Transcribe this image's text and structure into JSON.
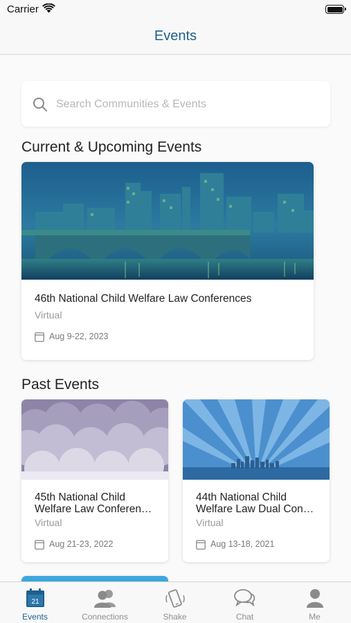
{
  "status": {
    "carrier": "Carrier"
  },
  "nav": {
    "title": "Events"
  },
  "search": {
    "placeholder": "Search Communities & Events"
  },
  "sections": {
    "current_title": "Current & Upcoming Events",
    "past_title": "Past Events"
  },
  "current_events": [
    {
      "title": "46th National Child Welfare Law Conferences",
      "location": "Virtual",
      "date": "Aug  9-22, 2023",
      "image": "city-bridge-skyline"
    }
  ],
  "past_events": [
    {
      "title_line1": "45th National Child",
      "title_line2": "Welfare Law Conferen…",
      "location": "Virtual",
      "date": "Aug 21-23, 2022",
      "image": "purple-clouds"
    },
    {
      "title_line1": "44th National Child",
      "title_line2": "Welfare Law Dual Con…",
      "location": "Virtual",
      "date": "Aug 13-18, 2021",
      "image": "blue-rays-skyline"
    }
  ],
  "tabs": [
    {
      "label": "Events",
      "icon": "calendar-icon",
      "active": true,
      "badge": "21"
    },
    {
      "label": "Connections",
      "icon": "people-icon",
      "active": false
    },
    {
      "label": "Shake",
      "icon": "phone-shake-icon",
      "active": false
    },
    {
      "label": "Chat",
      "icon": "chat-bubbles-icon",
      "active": false
    },
    {
      "label": "Me",
      "icon": "person-icon",
      "active": false
    }
  ],
  "colors": {
    "accent": "#1e5f8c",
    "inactive": "#8e8e8e"
  }
}
